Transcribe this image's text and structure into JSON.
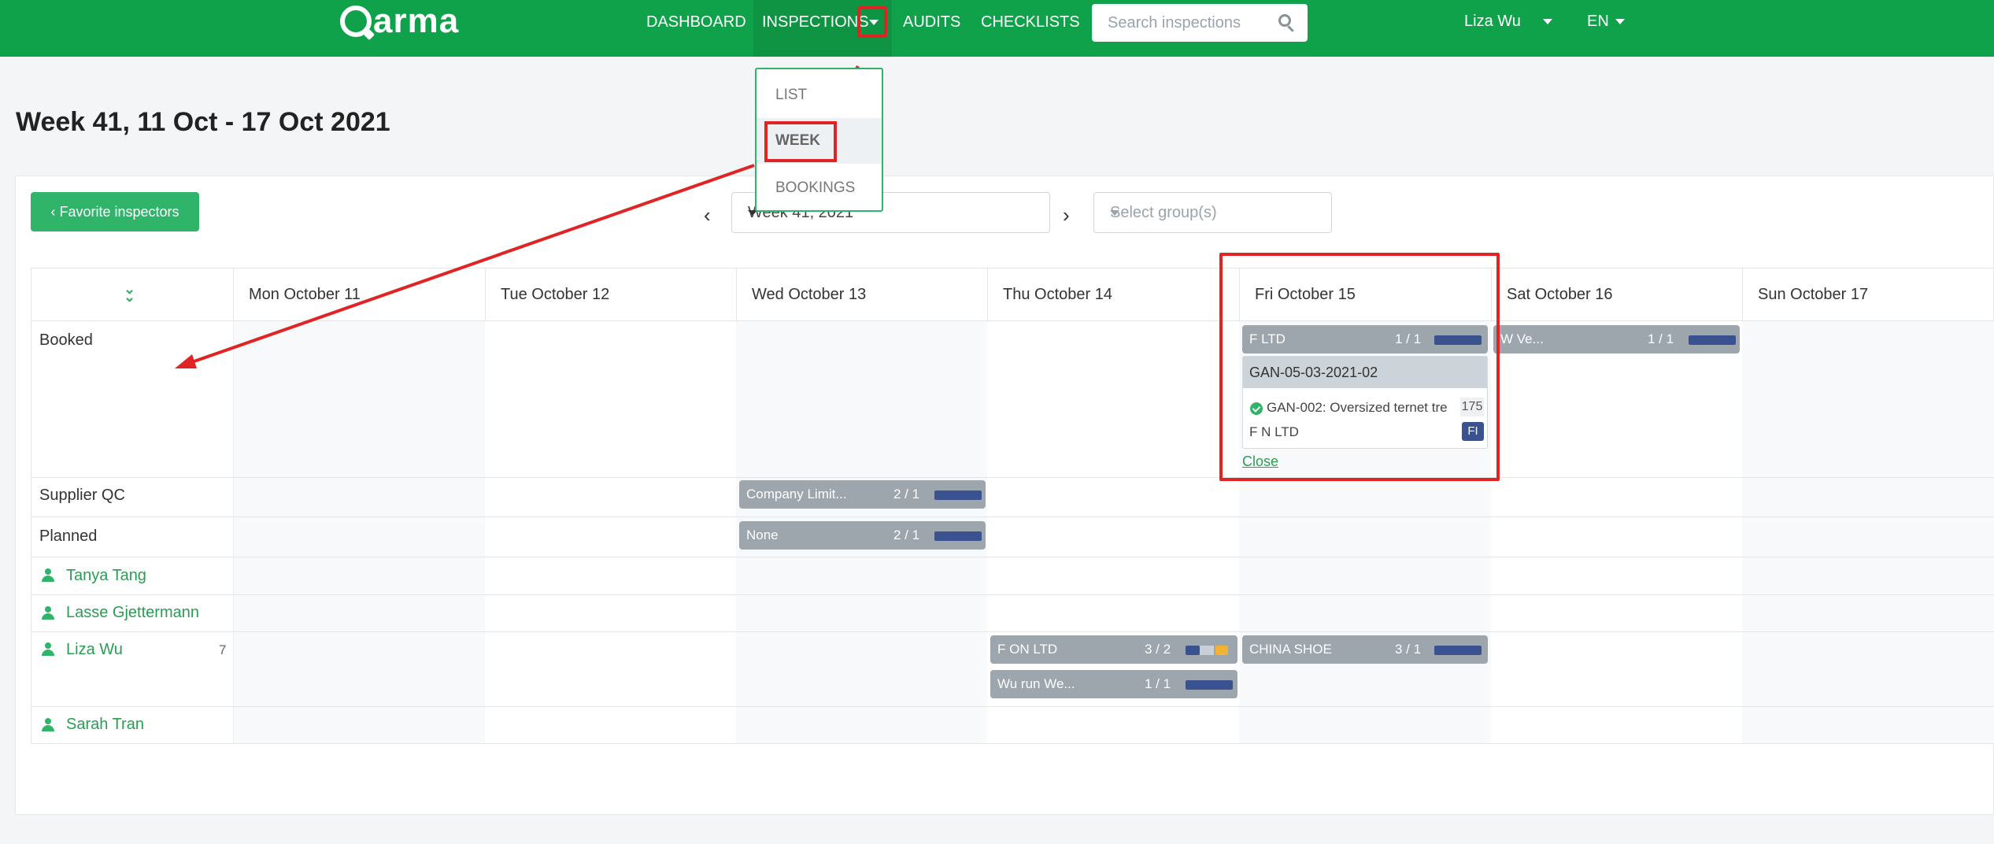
{
  "header": {
    "logo": "arma",
    "nav": {
      "dashboard": "DASHBOARD",
      "inspections": "INSPECTIONS",
      "audits": "AUDITS",
      "checklists": "CHECKLISTS"
    },
    "search_placeholder": "Search inspections",
    "user_name": "Liza Wu",
    "language": "EN"
  },
  "inspections_menu": {
    "items": [
      "LIST",
      "WEEK",
      "BOOKINGS"
    ],
    "selected": "WEEK"
  },
  "page_title": "Week 41, 11 Oct - 17 Oct 2021",
  "toolbar": {
    "favorite_button": "Favorite inspectors",
    "week_value": "Week 41, 2021",
    "group_placeholder": "Select group(s)"
  },
  "days": [
    "Mon October 11",
    "Tue October 12",
    "Wed October 13",
    "Thu October 14",
    "Fri October 15",
    "Sat October 16",
    "Sun October 17"
  ],
  "rows": {
    "booked": "Booked",
    "supplier_qc": "Supplier QC",
    "planned": "Planned"
  },
  "inspectors": [
    {
      "name": "Tanya Tang",
      "count": ""
    },
    {
      "name": "Lasse Gjettermann",
      "count": ""
    },
    {
      "name": "Liza Wu",
      "count": "7"
    },
    {
      "name": "Sarah Tran",
      "count": ""
    }
  ],
  "events": {
    "booked_fri": {
      "label": "F        LTD",
      "ratio": "1 / 1"
    },
    "booked_sat": {
      "label": "W                    Ve...",
      "ratio": "1 / 1"
    },
    "supplier_wed": {
      "label": "       Company Limit...",
      "ratio": "2 / 1"
    },
    "planned_wed": {
      "label": "None",
      "ratio": "2 / 1"
    },
    "liza_thu_1": {
      "label": "F        ON LTD",
      "ratio": "3 / 2"
    },
    "liza_thu_2": {
      "label": "Wu              run We...",
      "ratio": "1 / 1"
    },
    "liza_fri": {
      "label": "CHINA SHOE",
      "ratio": "3 / 1"
    }
  },
  "popover": {
    "order": "GAN-05-03-2021-02",
    "item": "GAN-002: Oversized ternet tre",
    "item_qty": "175",
    "supplier": "F        N LTD",
    "badge": "FI",
    "close": "Close"
  },
  "colors": {
    "brand_green": "#10a24a",
    "annotation_red": "#e02424",
    "progress_blue": "#3a5290"
  }
}
